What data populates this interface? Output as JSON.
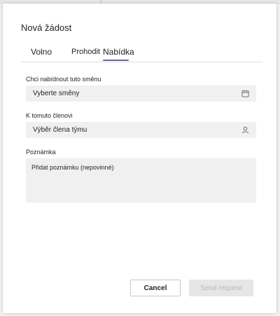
{
  "dialog": {
    "title": "Nová žádost"
  },
  "tabs": [
    {
      "label": "Volno",
      "active": false
    },
    {
      "label": "Prohodit",
      "active": false
    },
    {
      "label": "Nabídka",
      "active": true
    }
  ],
  "fields": {
    "shift": {
      "label": "Chci nabídnout tuto směnu",
      "placeholder": "Vyberte směny",
      "icon": "calendar-icon"
    },
    "member": {
      "label": "K tomuto členovi",
      "placeholder": "Výběr člena týmu",
      "icon": "person-icon"
    },
    "note": {
      "label": "Poznámka",
      "placeholder": "Přidat poznámku (nepovinné)"
    }
  },
  "buttons": {
    "cancel": "Cancel",
    "send": "Send request"
  },
  "colors": {
    "accent": "#6264a7",
    "field_bg": "#f0f0f0",
    "disabled_text": "#b8b8b8"
  }
}
